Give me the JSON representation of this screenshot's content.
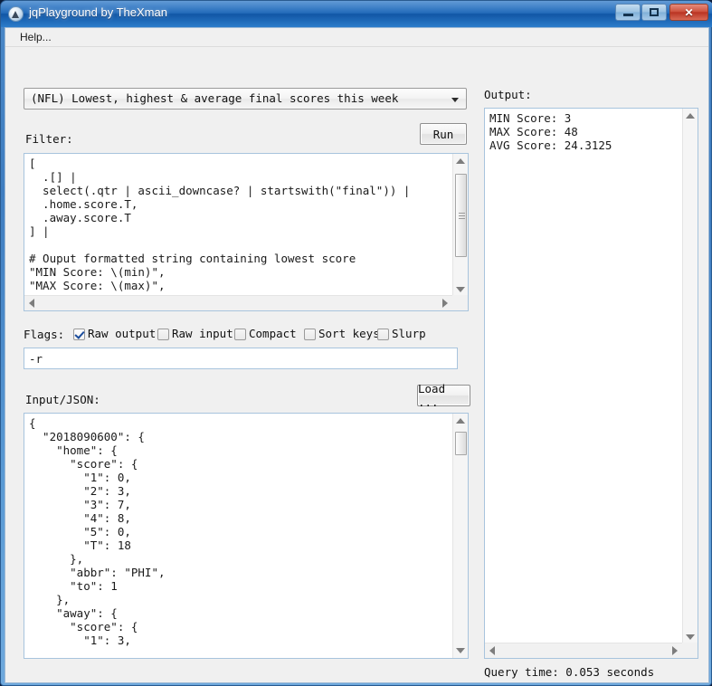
{
  "window": {
    "title": "jqPlayground by TheXman",
    "icon": "app-triangle-icon",
    "minimize_label": "",
    "maximize_label": "",
    "close_label": "✕"
  },
  "menu": {
    "help_label": "Help..."
  },
  "example_select": {
    "selected": "(NFL) Lowest, highest & average final scores this week",
    "arrow": "chevron-down-icon"
  },
  "filter": {
    "label": "Filter:",
    "run_label": "Run",
    "text": "[\n  .[] |\n  select(.qtr | ascii_downcase? | startswith(\"final\")) |\n  .home.score.T,\n  .away.score.T\n] |\n\n# Ouput formatted string containing lowest score\n\"MIN Score: \\(min)\",\n\"MAX Score: \\(max)\","
  },
  "flags": {
    "label": "Flags:",
    "options": [
      {
        "label": "Raw output",
        "checked": true
      },
      {
        "label": "Raw input",
        "checked": false
      },
      {
        "label": "Compact",
        "checked": false
      },
      {
        "label": "Sort keys",
        "checked": false
      },
      {
        "label": "Slurp",
        "checked": false
      }
    ],
    "value": "-r"
  },
  "input": {
    "label": "Input/JSON:",
    "load_label": "Load ...",
    "text": "{\n  \"2018090600\": {\n    \"home\": {\n      \"score\": {\n        \"1\": 0,\n        \"2\": 3,\n        \"3\": 7,\n        \"4\": 8,\n        \"5\": 0,\n        \"T\": 18\n      },\n      \"abbr\": \"PHI\",\n      \"to\": 1\n    },\n    \"away\": {\n      \"score\": {\n        \"1\": 3,"
  },
  "output": {
    "label": "Output:",
    "text": "MIN Score: 3\nMAX Score: 48\nAVG Score: 24.3125"
  },
  "status": {
    "query_time": "Query time: 0.053 seconds"
  },
  "colors": {
    "accent": "#1763b6",
    "close_button": "#b93423",
    "textbox_border": "#a8c4dd",
    "client_background": "#f0f0f0"
  }
}
